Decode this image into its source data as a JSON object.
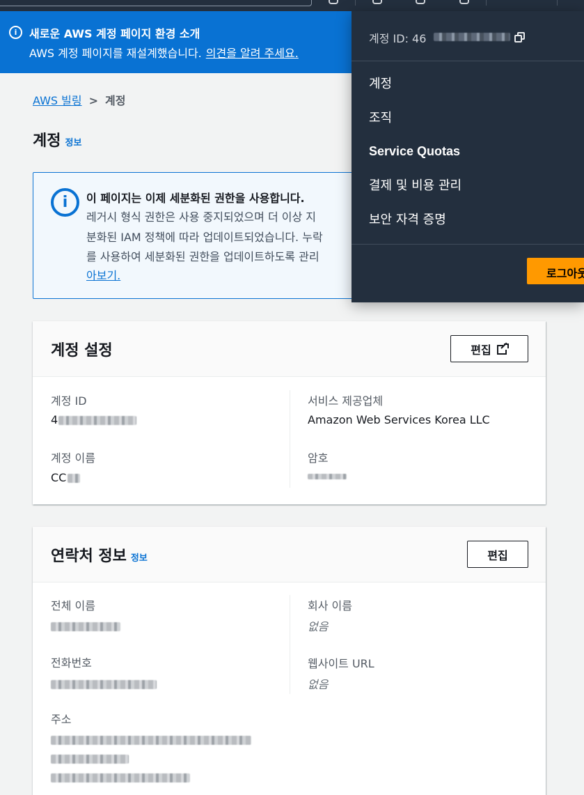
{
  "banner": {
    "title": "새로운 AWS 계정 페이지 환경 소개",
    "text": "AWS 계정 페이지를 재설계했습니다.",
    "link": "의견을 알려 주세요."
  },
  "breadcrumb": {
    "root": "AWS 빌링",
    "current": "계정"
  },
  "page": {
    "title": "계정",
    "info": "정보"
  },
  "alert": {
    "title": "이 페이지는 이제 세분화된 권한을 사용합니다.",
    "lines": [
      "레거시 형식 권한은 사용 중지되었으며 더 이상 지",
      "분화된 IAM 정책에 따라 업데이트되었습니다. 누락",
      "를 사용하여 세분화된 권한을 업데이트하도록 관리"
    ],
    "more": "아보기."
  },
  "account_settings": {
    "title": "계정 설정",
    "edit": "편집",
    "account_id_label": "계정 ID",
    "account_id_value": "4",
    "account_name_label": "계정 이름",
    "account_name_value": "CC",
    "provider_label": "서비스 제공업체",
    "provider_value": "Amazon Web Services Korea LLC",
    "password_label": "암호"
  },
  "contact": {
    "title": "연락처 정보",
    "info": "정보",
    "edit": "편집",
    "full_name_label": "전체 이름",
    "company_label": "회사 이름",
    "company_value": "없음",
    "phone_label": "전화번호",
    "website_label": "웹사이트 URL",
    "website_value": "없음",
    "address_label": "주소"
  },
  "dropdown": {
    "account_id": "계정 ID: 46",
    "items": [
      "계정",
      "조직",
      "Service Quotas",
      "결제 및 비용 관리",
      "보안 자격 증명"
    ],
    "signout": "로그아웃"
  },
  "colors": {
    "banner": "#0972d3",
    "nav": "#232f3e",
    "signout": "#ff9900",
    "link": "#0972d3"
  }
}
